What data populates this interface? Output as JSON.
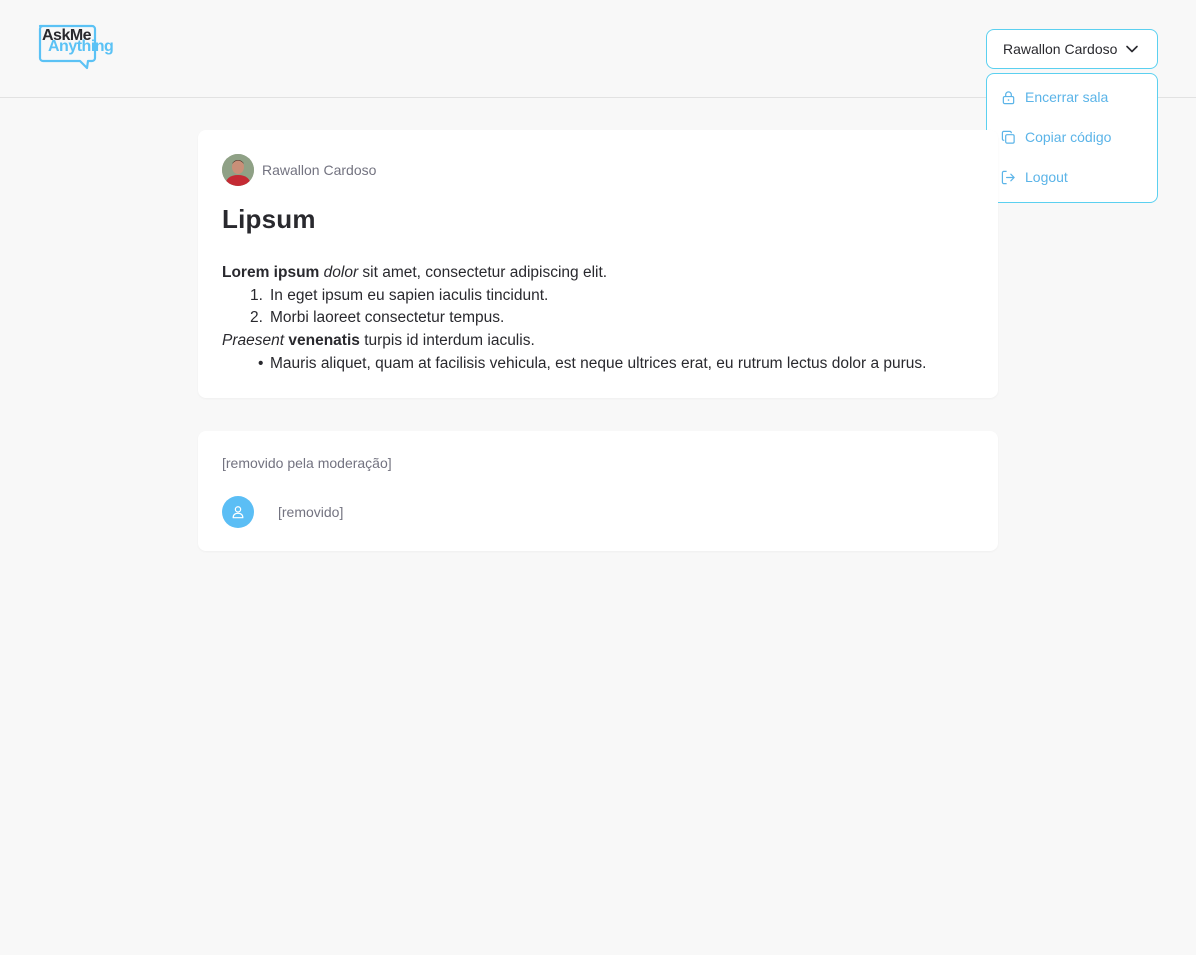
{
  "brand": {
    "line1": "AskMe",
    "line2": "Anything",
    "accent": "#5bc2f5"
  },
  "user_menu": {
    "name": "Rawallon Cardoso",
    "items": [
      {
        "label": "Encerrar sala",
        "icon": "lock-icon"
      },
      {
        "label": "Copiar código",
        "icon": "copy-icon"
      },
      {
        "label": "Logout",
        "icon": "logout-icon"
      }
    ],
    "border_color": "#5bd0f0",
    "item_color": "#5bb4e8"
  },
  "question": {
    "author": "Rawallon Cardoso",
    "title": "Lipsum",
    "p1_bold": "Lorem ipsum",
    "p1_italic": "dolor",
    "p1_rest": "sit amet, consectetur adipiscing elit.",
    "ordered": [
      {
        "num": "1.",
        "text": "In eget ipsum eu sapien iaculis tincidunt."
      },
      {
        "num": "2.",
        "text": "Morbi laoreet consectetur tempus."
      }
    ],
    "p2_italic": "Praesent",
    "p2_bold": "venenatis",
    "p2_rest": "turpis id interdum iaculis.",
    "bullet": "•",
    "unordered": [
      "Mauris aliquet, quam at facilisis vehicula, est neque ultrices erat, eu rutrum lectus dolor a purus."
    ]
  },
  "moderated": {
    "question_text": "[removido pela moderação]",
    "answer_text": "[removido]"
  }
}
